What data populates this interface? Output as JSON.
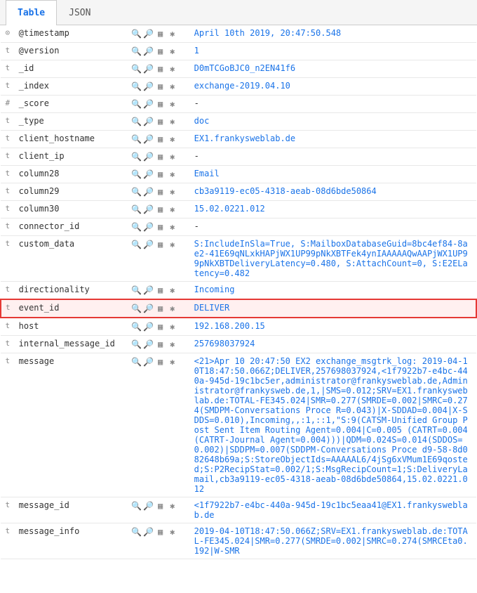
{
  "tabs": [
    {
      "id": "table",
      "label": "Table",
      "active": true
    },
    {
      "id": "json",
      "label": "JSON",
      "active": false
    }
  ],
  "rows": [
    {
      "type": "⊙",
      "field": "@timestamp",
      "value": "April 10th 2019, 20:47:50.548",
      "highlighted": false,
      "value_color": "blue"
    },
    {
      "type": "t",
      "field": "@version",
      "value": "1",
      "highlighted": false,
      "value_color": "blue"
    },
    {
      "type": "t",
      "field": "_id",
      "value": "D0mTCGoBJC0_n2EN41f6",
      "highlighted": false,
      "value_color": "blue"
    },
    {
      "type": "t",
      "field": "_index",
      "value": "exchange-2019.04.10",
      "highlighted": false,
      "value_color": "blue"
    },
    {
      "type": "#",
      "field": "_score",
      "value": "-",
      "highlighted": false,
      "value_color": "dark"
    },
    {
      "type": "t",
      "field": "_type",
      "value": "doc",
      "highlighted": false,
      "value_color": "blue"
    },
    {
      "type": "t",
      "field": "client_hostname",
      "value": "EX1.frankysweblab.de",
      "highlighted": false,
      "value_color": "blue"
    },
    {
      "type": "t",
      "field": "client_ip",
      "value": "-",
      "highlighted": false,
      "value_color": "dark"
    },
    {
      "type": "t",
      "field": "column28",
      "value": "Email",
      "highlighted": false,
      "value_color": "blue"
    },
    {
      "type": "t",
      "field": "column29",
      "value": "cb3a9119-ec05-4318-aeab-08d6bde50864",
      "highlighted": false,
      "value_color": "blue"
    },
    {
      "type": "t",
      "field": "column30",
      "value": "15.02.0221.012",
      "highlighted": false,
      "value_color": "blue"
    },
    {
      "type": "t",
      "field": "connector_id",
      "value": "-",
      "highlighted": false,
      "value_color": "dark"
    },
    {
      "type": "t",
      "field": "custom_data",
      "value": "S:IncludeInSla=True, S:MailboxDatabaseGuid=8bc4ef84-8ae2-41E69qNLxkHAPjWX1UP99pNkXBTFek4ynIAAAAAQwAAPjWX1UP99pNkXBTDeliveryLatency=0.480, S:AttachCount=0, S:E2ELatency=0.482",
      "highlighted": false,
      "value_color": "blue"
    },
    {
      "type": "t",
      "field": "directionality",
      "value": "Incoming",
      "highlighted": false,
      "value_color": "blue"
    },
    {
      "type": "t",
      "field": "event_id",
      "value": "DELIVER",
      "highlighted": true,
      "value_color": "blue"
    },
    {
      "type": "t",
      "field": "host",
      "value": "192.168.200.15",
      "highlighted": false,
      "value_color": "blue"
    },
    {
      "type": "t",
      "field": "internal_message_id",
      "value": "257698037924",
      "highlighted": false,
      "value_color": "blue",
      "value_highlight": true
    },
    {
      "type": "t",
      "field": "message",
      "value": "<21>Apr 10 20:47:50 EX2 exchange_msgtrk_log: 2019-04-10T18:47:50.066Z;DELIVER,257698037924,<1f7922b7-e4bc-440a-945d-19c1bc5er,administrator@frankysweblab.de,Administrator@frankysweb.de,1,|SMS=0.012;SRV=EX1.frankysweblab.de:TOTAL-FE345.024|SMR=0.277(SMRDE=0.002|SMRC=0.274(SMDPM-Conversations Proce R=0.043)|X-SDDAD=0.004|X-SDDS=0.010),Incoming,,:1,::1,\"S:9(CATSM-Unified Group Post Sent Item Routing Agent=0.004|C=0.005 (CATRT=0.004(CATRT-Journal Agent=0.004)))|QDM=0.024S=0.014(SDDOS=0.002)|SDDPM=0.007(SDDPM-Conversations Proce d9-58-8d082648b69a;S:StoreObjectIds=AAAAAL6/4jSg6xVMum1E69qosted;S:P2RecipStat=0.002/1;S:MsgRecipCount=1;S:DeliveryLamail,cb3a9119-ec05-4318-aeab-08d6bde50864,15.02.0221.012",
      "highlighted": false,
      "value_color": "blue"
    },
    {
      "type": "t",
      "field": "message_id",
      "value": "<1f7922b7-e4bc-440a-945d-19c1bc5eaa41@EX1.frankysweblab.de",
      "highlighted": false,
      "value_color": "blue"
    },
    {
      "type": "t",
      "field": "message_info",
      "value": "2019-04-10T18:47:50.066Z;SRV=EX1.frankysweblab.de:TOTAL-FE345.024|SMR=0.277(SMRDE=0.002|SMRC=0.274(SMRCEta0.192|W-SMR",
      "highlighted": false,
      "value_color": "blue"
    }
  ],
  "actions": {
    "magnify_plus": "🔍",
    "magnify_minus": "🔎",
    "grid": "⊞",
    "star": "★"
  }
}
